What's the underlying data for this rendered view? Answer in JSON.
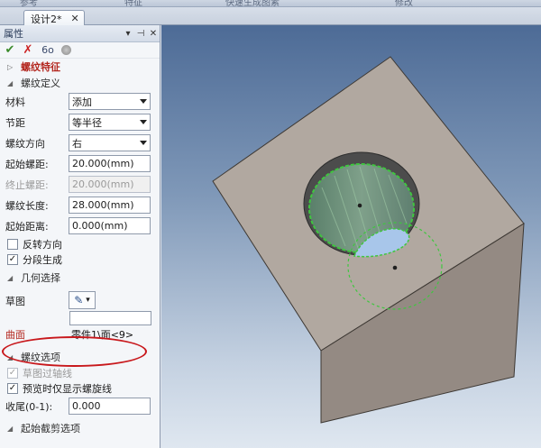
{
  "top_strip": {
    "labels": [
      "参考",
      "特征",
      "快速生成图素",
      "修改"
    ]
  },
  "document_tab": {
    "label": "设计2*",
    "close_glyph": "✕"
  },
  "panel": {
    "title": "属性",
    "controls": {
      "dropdown": "▾",
      "pin": "⊣",
      "close": "✕"
    },
    "toolbar": {
      "ok": "✔",
      "cancel": "✗",
      "preview": "6ο"
    },
    "feature_header": "螺纹特征",
    "thread_def": {
      "header": "螺纹定义",
      "material": {
        "label": "材料",
        "value": "添加"
      },
      "pitch": {
        "label": "节距",
        "value": "等半径"
      },
      "direction": {
        "label": "螺纹方向",
        "value": "右"
      },
      "start_pitch": {
        "label": "起始螺距:",
        "value": "20.000(mm)"
      },
      "end_pitch": {
        "label": "终止螺距:",
        "value": "20.000(mm)"
      },
      "length": {
        "label": "螺纹长度:",
        "value": "28.000(mm)"
      },
      "start_distance": {
        "label": "起始距离:",
        "value": "0.000(mm)"
      },
      "reverse": {
        "label": "反转方向",
        "checked": false
      },
      "segmented": {
        "label": "分段生成",
        "checked": true,
        "mark": "✓"
      }
    },
    "geometry": {
      "header": "几何选择",
      "sketch_label": "草图",
      "sketch_button_icon": "✎",
      "face_label": "曲面",
      "face_value": "零件1\\面<9>"
    },
    "thread_options": {
      "header": "螺纹选项",
      "sketch_axis": {
        "label": "草图过轴线",
        "checked": true,
        "mark": "✓"
      },
      "preview_helix": {
        "label": "预览时仅显示螺旋线",
        "checked": true,
        "mark": "✓"
      },
      "tail": {
        "label": "收尾(0-1):",
        "value": "0.000"
      }
    },
    "start_trim_header": "起始截剪选项"
  },
  "colors": {
    "highlight_oval": "#c8181c",
    "feature_header": "#b3261e",
    "block_top": "#b0a8a1",
    "block_side": "#948b84",
    "hole_highlight": "#3fc63f"
  }
}
